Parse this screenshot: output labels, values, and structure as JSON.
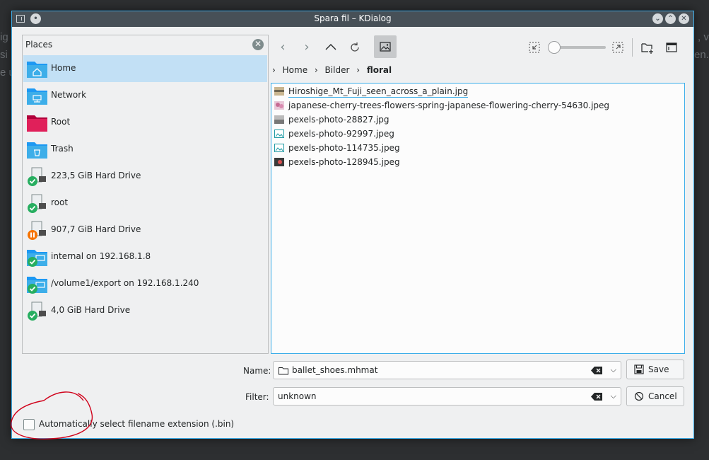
{
  "window": {
    "title": "Spara fil – KDialog"
  },
  "background": {
    "left_fragments": [
      "ig",
      "si",
      "e u"
    ],
    "right_fragments": [
      ", v",
      "en."
    ]
  },
  "places": {
    "header": "Places",
    "items": [
      {
        "label": "Home",
        "icon": "home-folder-icon",
        "selected": true
      },
      {
        "label": "Network",
        "icon": "network-folder-icon",
        "selected": false
      },
      {
        "label": "Root",
        "icon": "root-folder-icon",
        "selected": false
      },
      {
        "label": "Trash",
        "icon": "trash-folder-icon",
        "selected": false
      },
      {
        "label": "223,5 GiB Hard Drive",
        "icon": "hard-drive-mounted-icon",
        "selected": false
      },
      {
        "label": "root",
        "icon": "hard-drive-mounted-icon",
        "selected": false
      },
      {
        "label": "907,7 GiB Hard Drive",
        "icon": "hard-drive-paused-icon",
        "selected": false
      },
      {
        "label": "internal on 192.168.1.8",
        "icon": "network-share-mounted-icon",
        "selected": false
      },
      {
        "label": "/volume1/export on 192.168.1.240",
        "icon": "network-share-mounted-icon",
        "selected": false
      },
      {
        "label": "4,0 GiB Hard Drive",
        "icon": "hard-drive-mounted-icon",
        "selected": false
      }
    ]
  },
  "breadcrumb": {
    "items": [
      "Home",
      "Bilder",
      "floral"
    ]
  },
  "files": [
    {
      "name": "Hiroshige_Mt_Fuji_seen_across_a_plain.jpg",
      "icon": "image-thumb-icon",
      "current": true
    },
    {
      "name": "japanese-cherry-trees-flowers-spring-japanese-flowering-cherry-54630.jpeg",
      "icon": "image-thumb-icon",
      "current": false
    },
    {
      "name": "pexels-photo-28827.jpg",
      "icon": "image-thumb-icon",
      "current": false
    },
    {
      "name": "pexels-photo-92997.jpeg",
      "icon": "image-file-icon",
      "current": false
    },
    {
      "name": "pexels-photo-114735.jpeg",
      "icon": "image-file-icon",
      "current": false
    },
    {
      "name": "pexels-photo-128945.jpeg",
      "icon": "image-thumb-icon",
      "current": false
    }
  ],
  "name_field": {
    "label": "Name:",
    "value": "ballet_shoes.mhmat"
  },
  "filter_field": {
    "label": "Filter:",
    "value": "unknown"
  },
  "buttons": {
    "save": "Save",
    "cancel": "Cancel"
  },
  "options": {
    "auto_extension_label": "Automatically select filename extension (.bin)",
    "auto_extension_checked": false
  },
  "colors": {
    "accent": "#3daee9",
    "selection": "#c2e0f5",
    "titlebar": "#475057",
    "annotation": "#d0021b"
  }
}
